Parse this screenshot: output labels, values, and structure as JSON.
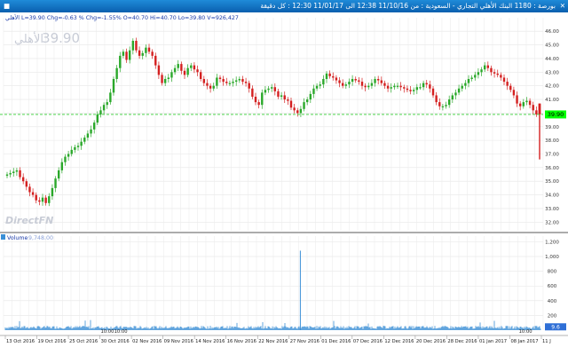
{
  "window": {
    "title": "بورصة : 1180 البنك الأهلي التجاري - السعودية : من 11/10/16 12:38 الى 11/01/17 12:30 : كل دقيقة",
    "icon": "chart-window-icon",
    "close_icon": "close-icon",
    "pin_icon": "pin-icon"
  },
  "price_panel": {
    "stats": "الأهلي L=39.90 Chg=-0.63 % Chg=-1.55% O=40.70 Hi=40.70 Lo=39.80 V=926,427",
    "big_price": "39.90",
    "big_name": "الأهلي",
    "watermark": "DirectFN",
    "last_price_label": "39.90",
    "last_price_color": "#00ff00",
    "up_color": "#2aa82a",
    "down_color": "#d42020",
    "reference_line_color": "#33cc33"
  },
  "volume_panel": {
    "label": "Volume",
    "value": "9,748.00",
    "last_volume_label": "9.6",
    "volume_color": "#3a8fd6"
  },
  "chart_data": {
    "type": "candlestick",
    "price_axis": {
      "ticks": [
        32.0,
        33.0,
        34.0,
        35.0,
        36.0,
        37.0,
        38.0,
        39.0,
        40.0,
        41.0,
        42.0,
        43.0,
        44.0,
        45.0,
        46.0
      ],
      "tick_labels": [
        "32.00",
        "33.00",
        "34.00",
        "35.00",
        "36.00",
        "37.00",
        "38.00",
        "39.00",
        "40.00",
        "41.00",
        "42.00",
        "43.00",
        "44.00",
        "45.00",
        "46.00"
      ],
      "ylim": [
        31.5,
        46.6
      ],
      "reference_line": 39.9
    },
    "volume_axis": {
      "ticks": [
        200,
        400,
        600,
        800,
        1000,
        1200
      ],
      "tick_labels": [
        "200",
        "400",
        "600",
        "800",
        "1,000",
        "1,200"
      ],
      "ylim": [
        0,
        1230
      ]
    },
    "x_axis": {
      "date_labels": [
        "13 Oct 2016",
        "19 Oct 2016",
        "25 Oct 2016",
        "30 Oct 2016",
        "02 Nov 2016",
        "09 Nov 2016",
        "14 Nov 2016",
        "16 Nov 2016",
        "22 Nov 2016",
        "27 Nov 2016",
        "01 Dec 2016",
        "07 Dec 2016",
        "12 Dec 2016",
        "20 Dec 2016",
        "28 Dec 2016",
        "01 Jan 2017",
        "08 Jan 2017",
        "11 J"
      ],
      "time_labels": [
        "10:00",
        "10:00",
        "10:00"
      ],
      "vertical_grid": "daily",
      "grid": true
    },
    "series": [
      {
        "values": [
          35.5,
          35.6,
          35.7,
          35.8,
          35.3,
          35.0,
          34.6,
          34.2,
          34.0,
          33.6,
          33.5,
          33.8,
          33.4,
          33.9,
          34.5,
          35.2,
          35.8,
          36.4,
          36.8,
          37.0,
          37.3,
          37.5,
          37.6,
          37.9,
          38.2,
          38.5,
          38.8,
          39.3,
          39.9,
          40.2,
          40.6,
          40.8,
          41.5,
          42.5,
          43.3,
          44.2,
          44.5,
          43.9,
          44.6,
          45.3,
          44.6,
          44.2,
          44.4,
          44.8,
          44.5,
          44.2,
          43.5,
          42.8,
          42.2,
          42.5,
          42.6,
          43.0,
          43.3,
          43.6,
          43.1,
          42.8,
          43.3,
          43.5,
          43.2,
          43.0,
          42.5,
          42.2,
          42.0,
          41.8,
          42.0,
          42.6,
          42.5,
          42.3,
          42.2,
          42.2,
          42.3,
          42.4,
          42.5,
          42.3,
          42.2,
          41.8,
          41.2,
          40.8,
          40.6,
          41.5,
          41.7,
          41.8,
          41.9,
          41.6,
          41.2,
          41.3,
          41.0,
          40.9,
          40.4,
          40.2,
          40.0,
          40.3,
          40.8,
          41.0,
          41.4,
          41.8,
          42.0,
          42.1,
          42.5,
          42.9,
          42.7,
          42.6,
          42.4,
          42.2,
          42.0,
          42.1,
          42.3,
          42.5,
          42.4,
          42.3,
          42.0,
          41.9,
          42.0,
          42.2,
          42.5,
          42.4,
          42.2,
          42.0,
          41.8,
          41.9,
          42.0,
          42.0,
          41.9,
          41.8,
          41.7,
          41.6,
          41.7,
          41.9,
          41.9,
          42.2,
          42.1,
          41.8,
          41.3,
          40.8,
          40.5,
          40.5,
          40.6,
          41.0,
          41.3,
          41.5,
          41.8,
          42.0,
          42.2,
          42.5,
          42.6,
          42.8,
          43.0,
          43.2,
          43.5,
          43.3,
          43.0,
          42.9,
          42.8,
          42.6,
          42.3,
          42.0,
          41.7,
          41.3,
          40.7,
          40.5,
          40.8,
          40.9,
          40.6,
          40.2,
          39.9
        ]
      }
    ],
    "last_candle": {
      "open": 40.7,
      "high": 40.7,
      "low": 39.8,
      "close": 39.9,
      "spike_low": 36.6
    },
    "volume_spike": 1080,
    "volume_baseline": 45
  }
}
